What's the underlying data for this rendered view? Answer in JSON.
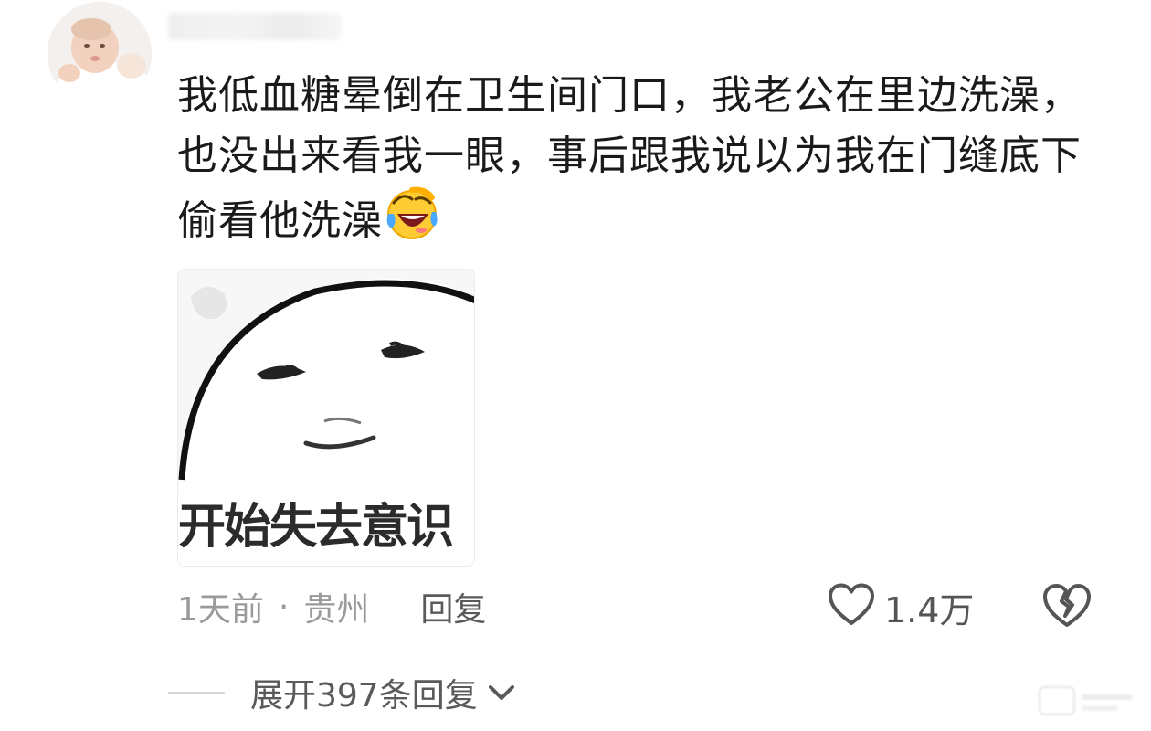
{
  "comment": {
    "text": "我低血糖晕倒在卫生间门口，我老公在里边洗澡，也没出来看我一眼，事后跟我说以为我在门缝底下偷看他洗澡",
    "emoji": "face-with-tears-of-joy-icon",
    "meme": {
      "caption": "开始失去意识"
    },
    "meta": {
      "time": "1天前",
      "separator": "·",
      "location": "贵州",
      "reply_label": "回复"
    },
    "likes": {
      "count": "1.4万",
      "icon": "heart-outline-icon"
    },
    "dislike": {
      "icon": "broken-heart-icon"
    },
    "expand": {
      "label": "展开397条回复",
      "icon": "chevron-down-icon"
    }
  },
  "colors": {
    "text_primary": "#1a1a1a",
    "text_secondary": "#9a9a9a",
    "text_action": "#5a5a5a"
  }
}
